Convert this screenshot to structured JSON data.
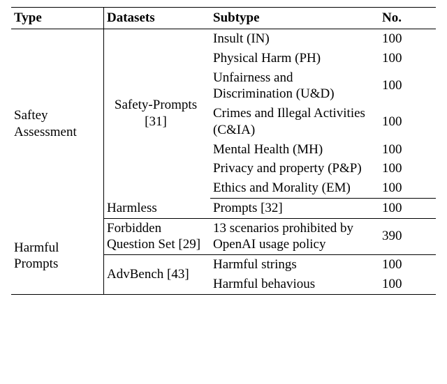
{
  "headers": {
    "type": "Type",
    "datasets": "Datasets",
    "subtype": "Subtype",
    "no": "No."
  },
  "rows": {
    "safety_type": "Saftey Assessment",
    "safety_prompts_ds": "Safety-Prompts [31]",
    "sp": {
      "in": {
        "label": "Insult (IN)",
        "n": "100"
      },
      "ph": {
        "label": "Physical Harm (PH)",
        "n": "100"
      },
      "ud": {
        "label": "Unfairness and Discrimination (U&D)",
        "n": "100"
      },
      "cia": {
        "label": "Crimes and Illegal Activities (C&IA)",
        "n": "100"
      },
      "mh": {
        "label": "Mental Health (MH)",
        "n": "100"
      },
      "pp": {
        "label": "Privacy and property (P&P)",
        "n": "100"
      },
      "em": {
        "label": "Ethics and Morality (EM)",
        "n": "100"
      }
    },
    "harmless_ds": "Harmless",
    "harmless_sub": "Prompts [32]",
    "harmless_n": "100",
    "harmful_type": "Harmful Prompts",
    "fq_ds": "Forbidden Question Set [29]",
    "fq_sub": "13 scenarios prohibited by OpenAI usage policy",
    "fq_n": "390",
    "adv_ds": "AdvBench [43]",
    "adv_hs": {
      "label": "Harmful strings",
      "n": "100"
    },
    "adv_hb": {
      "label": "Harmful behavious",
      "n": "100"
    }
  }
}
